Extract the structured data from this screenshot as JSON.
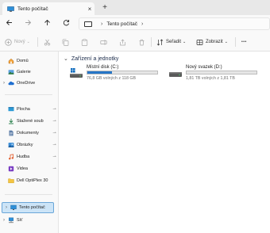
{
  "window": {
    "tab_title": "Tento počítač",
    "tab_close": "×",
    "new_tab": "+"
  },
  "address": {
    "separator": "›",
    "location": "Tento počítač",
    "trailing": "›"
  },
  "toolbar": {
    "new_label": "Nový",
    "sort_label": "Seřadit",
    "view_label": "Zobrazit",
    "more_label": "•••"
  },
  "sidebar": {
    "items": [
      {
        "label": "Domů",
        "icon": "home-icon"
      },
      {
        "label": "Galerie",
        "icon": "gallery-icon"
      },
      {
        "label": "OneDrive",
        "icon": "onedrive-icon"
      },
      {
        "label": "Plocha",
        "icon": "desktop-icon"
      },
      {
        "label": "Stažené soub",
        "icon": "download-icon"
      },
      {
        "label": "Dokumenty",
        "icon": "documents-icon"
      },
      {
        "label": "Obrázky",
        "icon": "pictures-icon"
      },
      {
        "label": "Hudba",
        "icon": "music-icon"
      },
      {
        "label": "Videa",
        "icon": "videos-icon"
      },
      {
        "label": "Dell OptiPlex 30",
        "icon": "folder-icon"
      },
      {
        "label": "Tento počítač",
        "icon": "this-pc-icon"
      },
      {
        "label": "Síť",
        "icon": "network-icon"
      }
    ],
    "pin": "📌"
  },
  "main": {
    "section_title": "Zařízení a jednotky",
    "drives": [
      {
        "name": "Místní disk (C:)",
        "free": "76,8 GB volných z 118 GB",
        "used_fraction": 0.35
      },
      {
        "name": "Nový svazek (D:)",
        "free": "1,81 TB volných z 1,81 TB",
        "used_fraction": 0.0
      }
    ]
  },
  "colors": {
    "accent": "#2676c7",
    "selection": "#cce4f7"
  }
}
